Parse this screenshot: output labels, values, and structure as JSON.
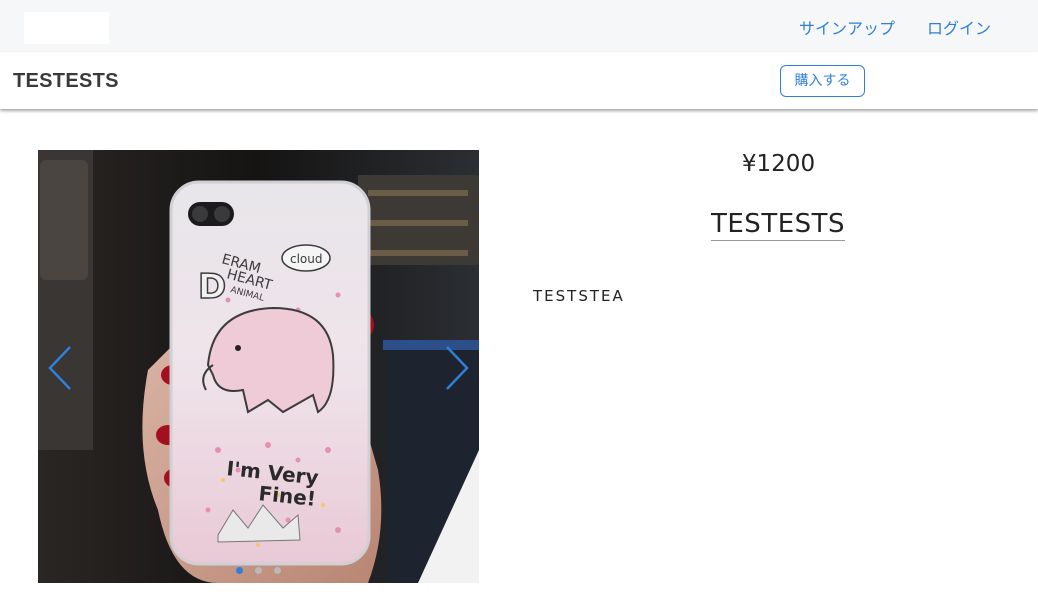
{
  "nav": {
    "signup_label": "サインアップ",
    "login_label": "ログイン"
  },
  "product_bar": {
    "title": "TESTESTS",
    "buy_label": "購入する"
  },
  "carousel": {
    "image_text": {
      "line1": "ERAM",
      "line2": "HEART",
      "line3": "ANIMAL",
      "cloud": "cloud",
      "phrase1": "I'm Very",
      "phrase2": "Fine!"
    },
    "slide_count": 3,
    "active_slide": 1
  },
  "product": {
    "price": "¥1200",
    "title": "TESTESTS",
    "description": "TESTSTEA"
  },
  "colors": {
    "accent": "#2f7fd9",
    "nav_bg": "#f6f7f9"
  }
}
